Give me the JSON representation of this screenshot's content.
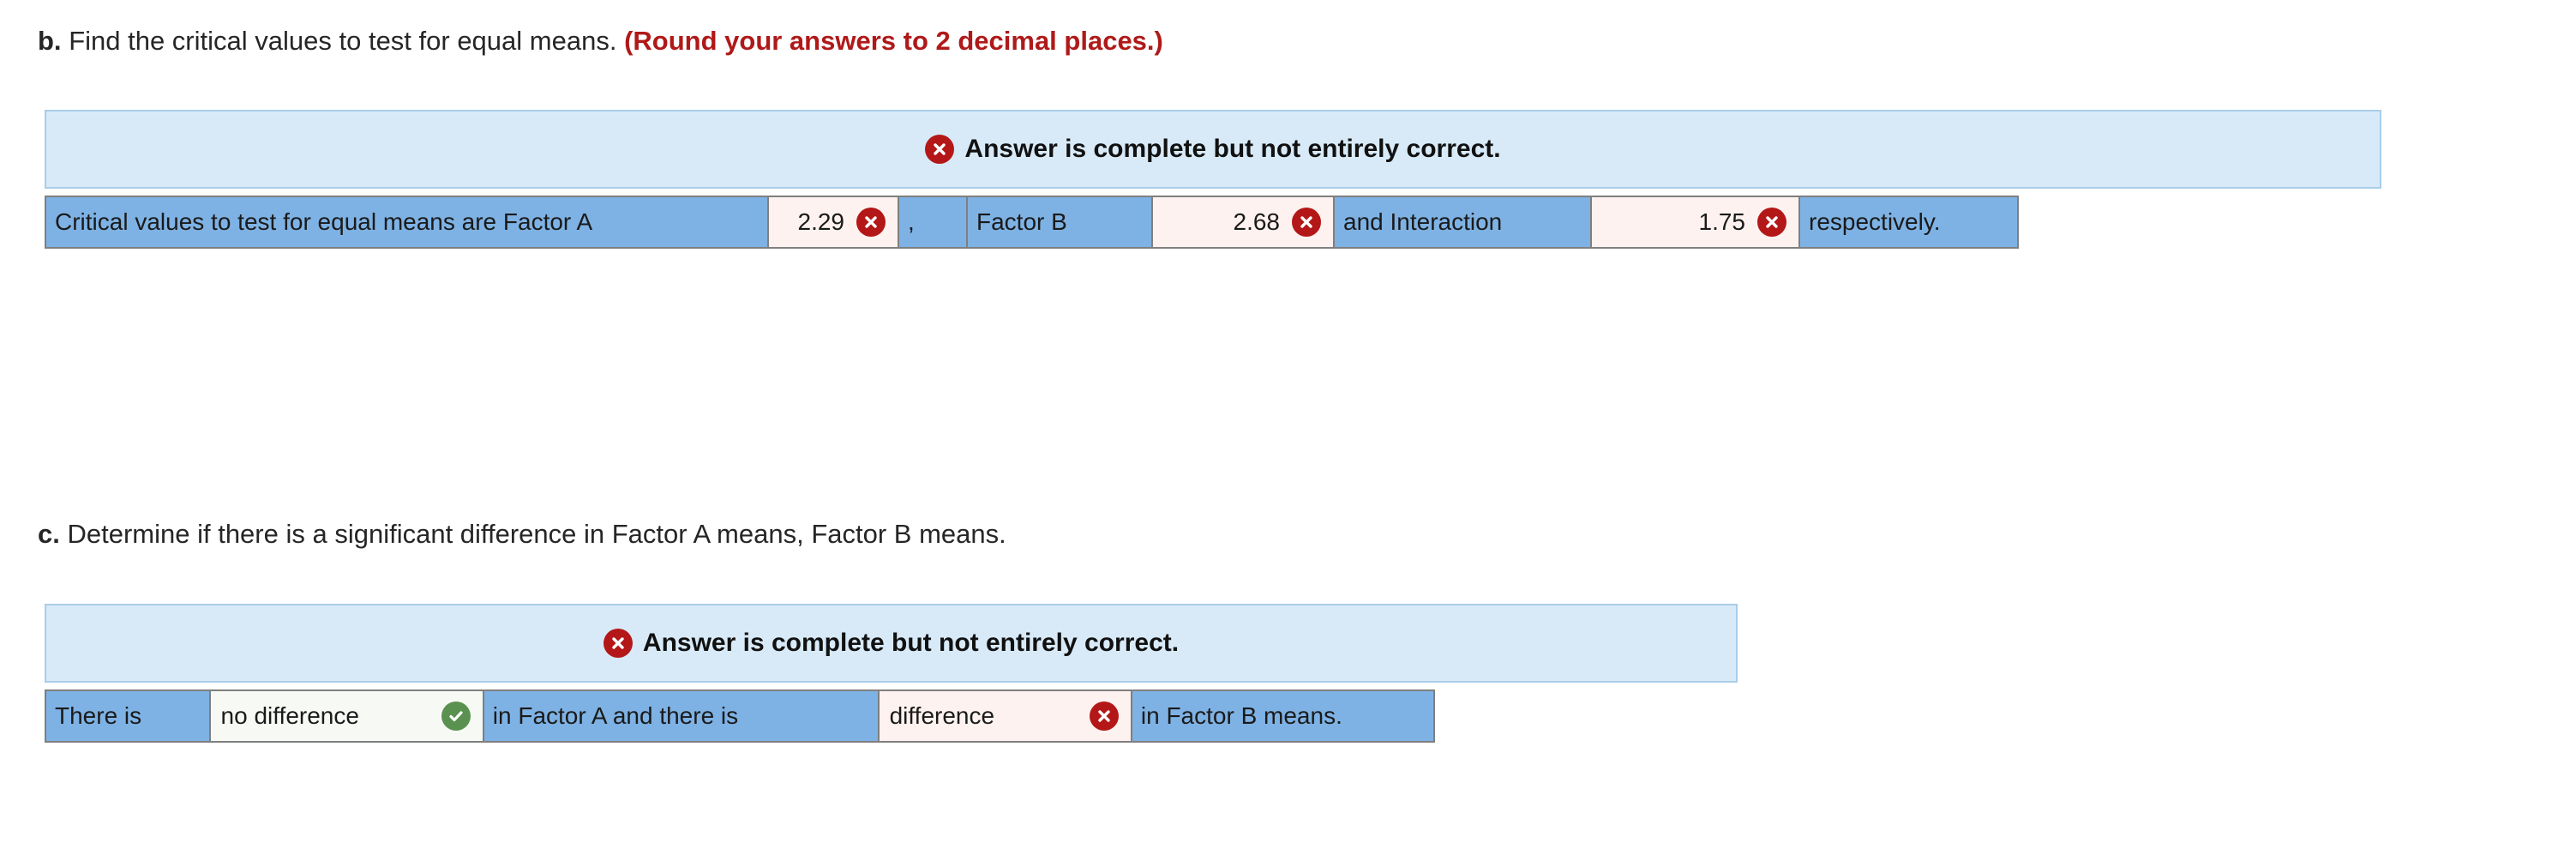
{
  "questions": [
    {
      "label": "b.",
      "text": "Find the critical values to test for equal means.",
      "note": "(Round your answers to 2 decimal places.)",
      "banner": {
        "icon": "x-circle-icon",
        "text": "Answer is complete but not entirely correct."
      },
      "row": [
        {
          "kind": "static",
          "text": "Critical values to test for equal means are Factor A"
        },
        {
          "kind": "input",
          "value": "2.29",
          "status": "incorrect",
          "icon": "x-circle-icon"
        },
        {
          "kind": "static",
          "text": ","
        },
        {
          "kind": "static",
          "text": "Factor B"
        },
        {
          "kind": "input",
          "value": "2.68",
          "status": "incorrect",
          "icon": "x-circle-icon"
        },
        {
          "kind": "static",
          "text": "and Interaction"
        },
        {
          "kind": "input",
          "value": "1.75",
          "status": "incorrect",
          "icon": "x-circle-icon"
        },
        {
          "kind": "static",
          "text": "respectively."
        }
      ]
    },
    {
      "label": "c.",
      "text": "Determine if there is a significant difference in Factor A means, Factor B means.",
      "note": "",
      "banner": {
        "icon": "x-circle-icon",
        "text": "Answer is complete but not entirely correct."
      },
      "row": [
        {
          "kind": "static",
          "text": "There is"
        },
        {
          "kind": "select",
          "value": "no difference",
          "status": "correct",
          "icon": "check-circle-icon"
        },
        {
          "kind": "static",
          "text": "in Factor A and there is"
        },
        {
          "kind": "select",
          "value": "difference",
          "status": "incorrect",
          "icon": "x-circle-icon"
        },
        {
          "kind": "static",
          "text": "in Factor B means."
        }
      ]
    }
  ],
  "colors": {
    "banner_background": "#d8eaf8",
    "banner_border": "#a9cde8",
    "cell_static_background": "#7eb2e4",
    "cell_border": "#7f7f7f",
    "incorrect_field_background": "#fdf2ef",
    "correct_field_background": "#f7faf4",
    "incorrect_icon": "#b41717",
    "correct_icon": "#5a9150",
    "note_text": "#b01919"
  }
}
